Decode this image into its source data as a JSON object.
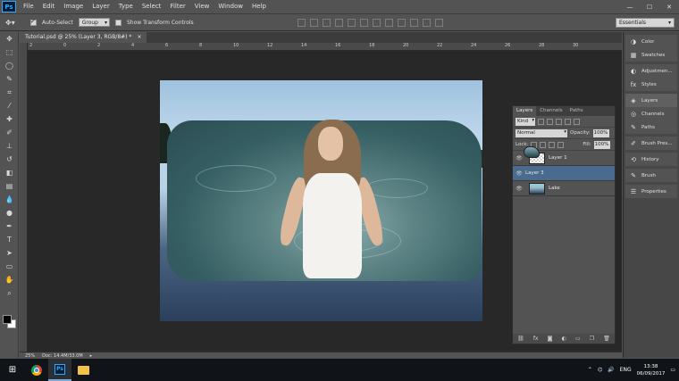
{
  "menubar": {
    "logo": "Ps",
    "items": [
      "File",
      "Edit",
      "Image",
      "Layer",
      "Type",
      "Select",
      "Filter",
      "View",
      "Window",
      "Help"
    ]
  },
  "window_controls": {
    "minimize": "—",
    "maximize": "☐",
    "close": "✕"
  },
  "options": {
    "auto_select_label": "Auto-Select",
    "auto_select_checked": true,
    "auto_select_target": "Group",
    "transform_label": "Show Transform Controls",
    "workspace": "Essentials"
  },
  "document": {
    "tab_title": "Tutorial.psd @ 25% (Layer 3, RGB/8#) *",
    "close": "×",
    "ruler_numbers": [
      "2",
      "0",
      "2",
      "4",
      "6",
      "8",
      "10",
      "12",
      "14",
      "16",
      "18",
      "20",
      "22",
      "24",
      "26",
      "28",
      "30"
    ]
  },
  "layers_panel": {
    "tabs": [
      "Layers",
      "Channels",
      "Paths"
    ],
    "filter_kind": "Kind",
    "blend_mode": "Normal",
    "opacity_label": "Opacity:",
    "opacity_value": "100%",
    "lock_label": "Lock:",
    "fill_label": "Fill:",
    "fill_value": "100%",
    "layers": [
      {
        "name": "Layer 1",
        "visible": true,
        "selected": false
      },
      {
        "name": "Layer 3",
        "visible": true,
        "selected": true
      },
      {
        "name": "Lake",
        "visible": true,
        "selected": false
      }
    ],
    "footer_icons": [
      "link-icon",
      "fx-icon",
      "mask-icon",
      "adjustment-icon",
      "group-icon",
      "new-layer-icon",
      "trash-icon"
    ],
    "fx_label": "fx"
  },
  "right_dock": {
    "group1": [
      "Color",
      "Swatches"
    ],
    "group2": [
      "Adjustmen...",
      "Styles"
    ],
    "group3": [
      "Layers",
      "Channels",
      "Paths"
    ],
    "group4": [
      "Brush Pres..."
    ],
    "group5": [
      "History"
    ],
    "group6": [
      "Brush"
    ],
    "group7": [
      "Properties"
    ]
  },
  "status": {
    "zoom": "25%",
    "doc_info": "Doc: 14.4M/33.0M"
  },
  "taskbar": {
    "tray_lang": "ENG",
    "time": "13:38",
    "date": "06/09/2017"
  }
}
